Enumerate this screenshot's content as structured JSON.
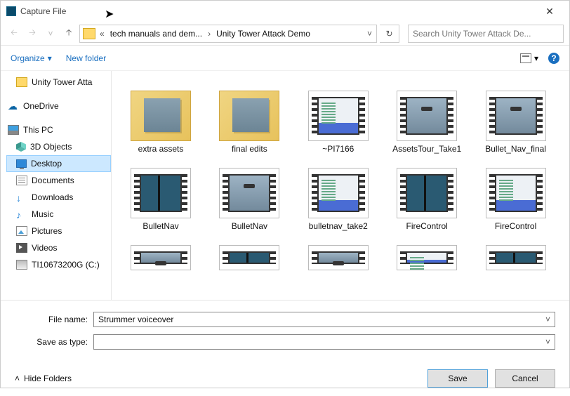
{
  "window": {
    "title": "Capture File"
  },
  "address": {
    "crumb1": "tech manuals and dem...",
    "crumb2": "Unity Tower Attack Demo"
  },
  "search": {
    "placeholder": "Search Unity Tower Attack De..."
  },
  "toolbar": {
    "organize": "Organize",
    "new_folder": "New folder"
  },
  "tree": {
    "folder1": "Unity Tower Atta",
    "onedrive": "OneDrive",
    "thispc": "This PC",
    "objects3d": "3D Objects",
    "desktop": "Desktop",
    "documents": "Documents",
    "downloads": "Downloads",
    "music": "Music",
    "pictures": "Pictures",
    "videos": "Videos",
    "drive": "TI10673200G (C:)"
  },
  "files": {
    "f0": "extra assets",
    "f1": "final edits",
    "f2": "~PI7166",
    "f3": "AssetsTour_Take1",
    "f4": "Bullet_Nav_final",
    "f5": "BulletNav",
    "f6": "BulletNav",
    "f7": "bulletnav_take2",
    "f8": "FireControl",
    "f9": "FireControl"
  },
  "inputs": {
    "filename_label": "File name:",
    "filename_value": "Strummer voiceover",
    "saveas_label": "Save as type:",
    "saveas_value": ""
  },
  "footer": {
    "hide": "Hide Folders",
    "save": "Save",
    "cancel": "Cancel"
  }
}
